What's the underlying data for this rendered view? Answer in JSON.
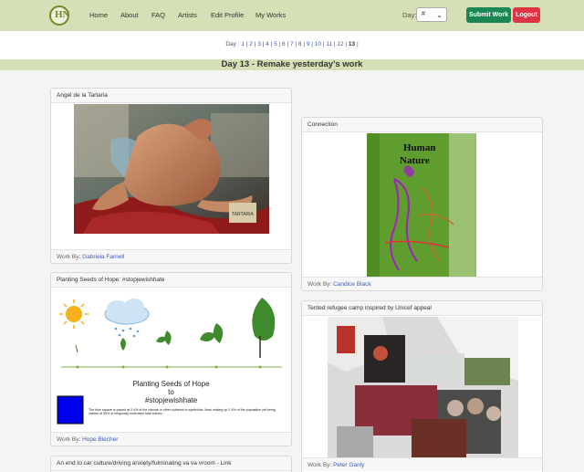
{
  "nav": {
    "logo_text": "HN",
    "links": [
      "Home",
      "About",
      "FAQ",
      "Artists",
      "Edit Profile",
      "My Works"
    ],
    "day_label": "Day:",
    "day_selected": "#",
    "submit_label": "Submit Work",
    "logout_label": "Logout"
  },
  "day_nav": {
    "prefix": "Day :",
    "days": [
      "1",
      "2",
      "3",
      "4",
      "5",
      "6",
      "7",
      "8",
      "9",
      "10",
      "11",
      "12",
      "13"
    ],
    "current": "13"
  },
  "page_title": "Day 13 - Remake yesterday's work",
  "works": [
    {
      "title": "Angel de la Tartaria",
      "by_label": "Work By:",
      "artist": "Gabriela Farnell"
    },
    {
      "title": "Connection",
      "by_label": "Work By:",
      "artist": "Candice Black",
      "art_text_1": "Human",
      "art_text_2": "Nature"
    },
    {
      "title": "Planting Seeds of Hope: #stopjewishhate",
      "by_label": "Work By:",
      "artist": "Hope Blecher",
      "art_line_1": "Planting Seeds of Hope",
      "art_line_2": "to",
      "art_line_3": "#stopjewishhate",
      "art_caption": "The blue square is placed at 2.4% of the canvas or other surfaces to symbolise Jews making up 2.4% of the population yet being victims of 55% of religiously motivated hate crimes."
    },
    {
      "title": "Tented refugee camp inspired by Unicef appeal",
      "by_label": "Work By:",
      "artist": "Peter Ganly"
    },
    {
      "title": "An end to car culture/driving anxiety/fulminating va va vroom - Link"
    }
  ],
  "colors": {
    "navbar_bg": "#d6e0b6",
    "submit_green": "#198754",
    "logout_red": "#dc3545",
    "link_blue": "#3a5bbf"
  }
}
